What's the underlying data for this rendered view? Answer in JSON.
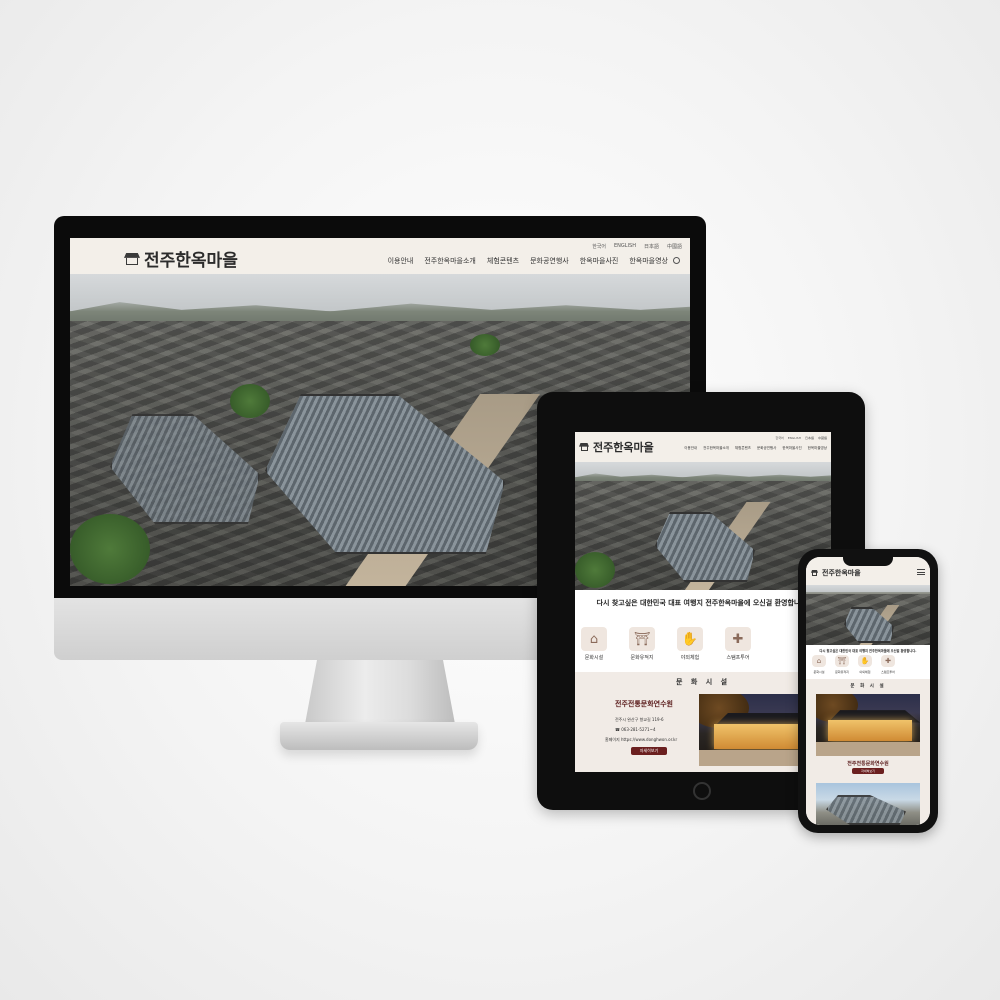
{
  "site": {
    "logo_text": "전주한옥마을",
    "nav": [
      "이용안내",
      "전주한옥마을소개",
      "체험콘텐츠",
      "문화공연행사",
      "한옥마을사진",
      "한옥마을영상"
    ],
    "languages": [
      "한국어",
      "ENGLISH",
      "日本語",
      "中國語"
    ],
    "welcome": "다시 찾고싶은 대한민국 대표 여행지 전주한옥마을에 오신걸 환영합니다.",
    "quick_icons": [
      {
        "label": "문화시설",
        "icon": "pavilion-icon"
      },
      {
        "label": "문화유적지",
        "icon": "gate-icon"
      },
      {
        "label": "야외체험",
        "icon": "hands-icon"
      },
      {
        "label": "스탬프투어",
        "icon": "stamp-icon"
      }
    ],
    "section_title": "문 화 시 설",
    "facility": {
      "name": "전주전통문화연수원",
      "address": "전주시 완산구 향교길 119-6",
      "phone": "☎ 063-281-5271~4",
      "homepage": "홈페이지 https://www.donghwon.or.kr",
      "button": "자세히보기"
    }
  },
  "colors": {
    "header_bg": "#f3efe9",
    "accent": "#6b1f1f",
    "section_bg": "#f1ebe6"
  },
  "devices": [
    "imac",
    "ipad",
    "iphone"
  ]
}
